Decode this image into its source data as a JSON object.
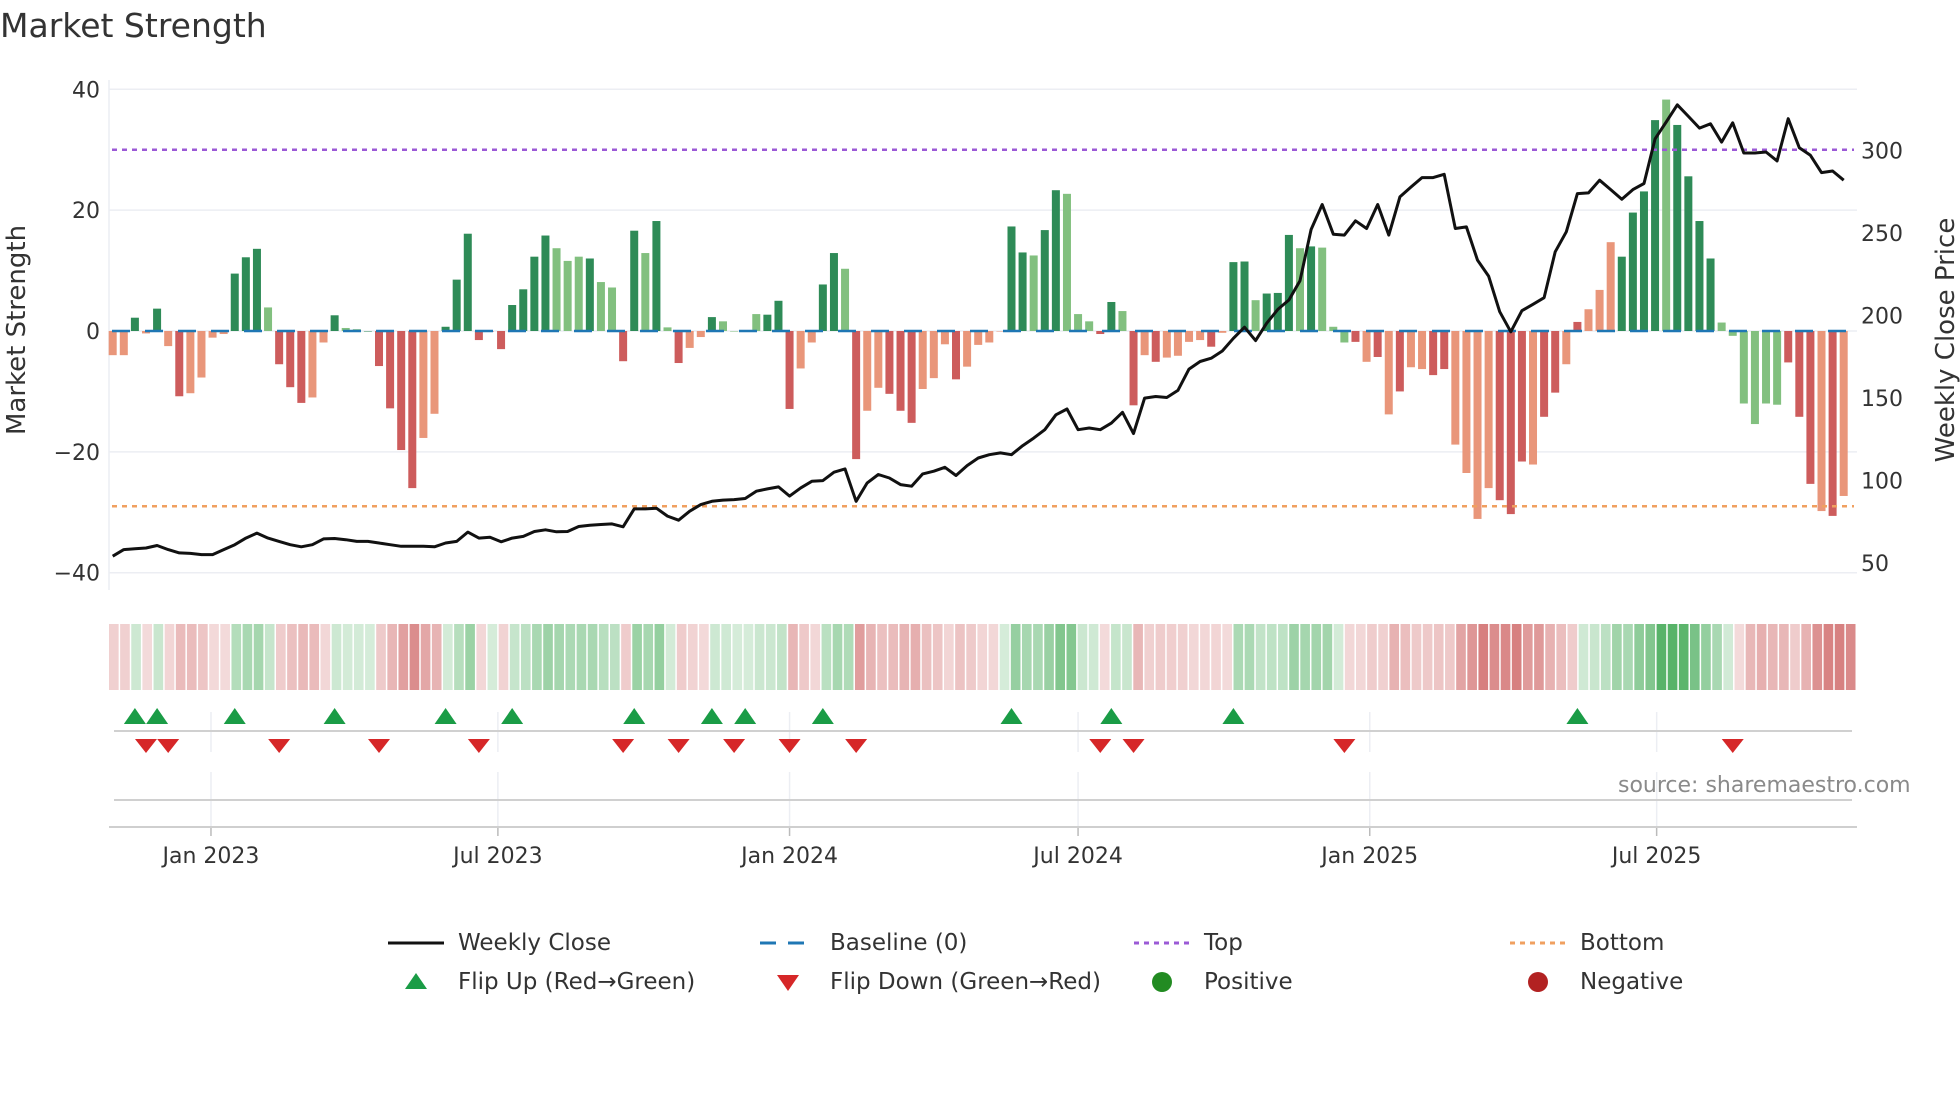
{
  "title": "Market Strength",
  "source": "source: sharemaestro.com",
  "chart_data": {
    "type": "bar",
    "title": "Market Strength",
    "ylabel": "Market Strength",
    "y2label": "Weekly Close Price",
    "ylim": [
      -40,
      40
    ],
    "y2lim": [
      44,
      337
    ],
    "yticks": [
      "40",
      "20",
      "0",
      "−20",
      "−40"
    ],
    "ytick_values": [
      40,
      20,
      0,
      -20,
      -40
    ],
    "y2ticks": [
      "50",
      "100",
      "150",
      "200",
      "250",
      "300"
    ],
    "y2tick_values": [
      50,
      100,
      150,
      200,
      250,
      300
    ],
    "xticks": [
      {
        "label": "Jan 2023",
        "date": "2023-01-01"
      },
      {
        "label": "Jul 2023",
        "date": "2023-07-01"
      },
      {
        "label": "Jan 2024",
        "date": "2024-01-01"
      },
      {
        "label": "Jul 2024",
        "date": "2024-07-01"
      },
      {
        "label": "Jan 2025",
        "date": "2025-01-01"
      },
      {
        "label": "Jul 2025",
        "date": "2025-07-01"
      }
    ],
    "start_date": "2022-10-31",
    "interval_days": 7,
    "top_level": 30,
    "bottom_level": -29,
    "baseline": 0,
    "strength": [
      -4,
      -4,
      2.2,
      -0.4,
      3.7,
      -2.5,
      -10.8,
      -10.3,
      -7.7,
      -1.1,
      -0.5,
      9.5,
      12.2,
      13.6,
      3.9,
      -5.5,
      -9.3,
      -11.9,
      -11,
      -1.9,
      2.6,
      0.5,
      0.3,
      0,
      -5.8,
      -12.8,
      -19.7,
      -26,
      -17.7,
      -13.7,
      0.7,
      8.5,
      16.1,
      -1.5,
      0,
      -3,
      4.3,
      6.9,
      12.3,
      15.8,
      13.7,
      11.6,
      12.3,
      12,
      8.1,
      7.2,
      -5,
      16.6,
      12.9,
      18.2,
      0.6,
      -5.3,
      -2.8,
      -1,
      2.3,
      1.6,
      0,
      0.1,
      2.8,
      2.7,
      5,
      -12.9,
      -6.2,
      -1.9,
      7.7,
      12.9,
      10.3,
      -21.2,
      -13.2,
      -9.4,
      -10.4,
      -13.2,
      -15.2,
      -9.6,
      -7.8,
      -2.2,
      -8,
      -5.9,
      -2.3,
      -1.9,
      0,
      17.3,
      13,
      12.5,
      16.7,
      23.3,
      22.7,
      2.8,
      1.6,
      -0.5,
      4.8,
      3.3,
      -12.3,
      -4,
      -5.1,
      -4.4,
      -4.1,
      -1.8,
      -1.5,
      -2.6,
      -0.3,
      11.4,
      11.5,
      5.1,
      6.2,
      6.3,
      15.9,
      13.7,
      14,
      13.8,
      0.7,
      -1.9,
      -1.8,
      -5.1,
      -4.3,
      -13.8,
      -10,
      -6,
      -6.3,
      -7.3,
      -6.3,
      -18.8,
      -23.5,
      -31.1,
      -26,
      -28,
      -30.3,
      -21.6,
      -22.1,
      -14.2,
      -10.2,
      -5.5,
      1.5,
      3.6,
      6.8,
      14.7,
      12.3,
      19.6,
      23.1,
      34.9,
      38.3,
      34.1,
      25.6,
      18.2,
      12,
      1.4,
      -0.8,
      -12,
      -15.4,
      -12,
      -12.2,
      -5.2,
      -14.2,
      -25.3,
      -29.8,
      -30.6,
      -27.3
    ],
    "bar_state": "rrGrGrRrrrrGGGgRRRrrGggGRRRRrrGGGRRRGGGGgggGggRGgGgRrrGggggGGRrrGGgRrrRRRrrrRrrrrGGgGGgggRGgRrRrrrrRrGGgGGGgGgggRrRrRrrRRrrrrRRRrRRrRrrrGGGGgGGGGggggggRRRrRrRRRRr",
    "close": [
      54,
      58,
      58.5,
      59,
      60.5,
      58,
      56,
      55.7,
      55,
      55,
      58,
      61,
      65,
      68,
      65,
      63,
      61,
      59.7,
      61,
      64.5,
      64.7,
      64,
      63,
      63,
      62,
      61,
      60,
      60,
      60,
      59.7,
      62,
      63,
      68.6,
      65,
      65.5,
      62.7,
      65,
      66,
      69,
      70,
      68.8,
      69,
      72,
      72.8,
      73.2,
      73.6,
      71.8,
      82.7,
      82.7,
      83.1,
      78.3,
      75.8,
      81.3,
      85.3,
      87.3,
      88,
      88.3,
      89,
      93.4,
      94.8,
      96,
      90.4,
      95.4,
      99.4,
      99.8,
      104.9,
      106.9,
      87.3,
      98.4,
      103.5,
      101.4,
      97.4,
      96.4,
      103.9,
      105.5,
      107.9,
      102.9,
      108.9,
      113.5,
      115.5,
      116.6,
      115.5,
      121,
      125.6,
      130.7,
      139.7,
      143.2,
      130.7,
      131.7,
      130.7,
      134.7,
      141.2,
      128.3,
      149.8,
      150.8,
      150.2,
      154.5,
      167.4,
      172,
      174,
      178.4,
      186.1,
      192.8,
      184.7,
      195.2,
      203.6,
      209.3,
      221,
      252,
      267.2,
      249.2,
      248.6,
      257.3,
      252.6,
      267.2,
      248.6,
      271.8,
      277.8,
      283.5,
      283.5,
      285.5,
      252.6,
      253.6,
      233.5,
      223.8,
      202.2,
      190,
      202.8,
      206.7,
      210.7,
      238.5,
      250.6,
      273.8,
      274.2,
      281.9,
      276.2,
      270.4,
      276.2,
      279.9,
      307,
      317.2,
      327.6,
      320.6,
      313.5,
      316.1,
      305,
      316.7,
      298.4,
      298.4,
      299,
      293.6,
      319.2,
      301.6,
      297,
      286.5,
      287.5,
      281.9
    ],
    "flip_up_index": [
      2,
      4,
      11,
      20,
      30,
      36,
      47,
      54,
      57,
      64,
      81,
      90,
      101,
      132
    ],
    "flip_down_index": [
      3,
      5,
      15,
      24,
      33,
      46,
      51,
      56,
      61,
      67,
      89,
      92,
      111,
      146
    ],
    "legend": [
      {
        "label": "Weekly Close",
        "symbol": "line"
      },
      {
        "label": "Baseline (0)",
        "symbol": "dash"
      },
      {
        "label": "Top",
        "symbol": "dot"
      },
      {
        "label": "Bottom",
        "symbol": "dot"
      },
      {
        "label": "Flip Up (Red→Green)",
        "symbol": "triangle-up"
      },
      {
        "label": "Flip Down (Green→Red)",
        "symbol": "triangle-down"
      },
      {
        "label": "Positive",
        "symbol": "circle"
      },
      {
        "label": "Negative",
        "symbol": "circle"
      }
    ],
    "legend_placement": "bottom"
  },
  "colors": {
    "strong_green": "#2e8b57",
    "weak_green": "#82c07f",
    "strong_red": "#cd5c5c",
    "weak_red": "#e9967a",
    "close_line": "#111111",
    "baseline": "#1f77b4",
    "top": "#9b59d6",
    "bottom": "#f0a060",
    "flip_up": "#1a9c46",
    "flip_down": "#d62728",
    "positive": "#228b22",
    "negative": "#b22222"
  }
}
